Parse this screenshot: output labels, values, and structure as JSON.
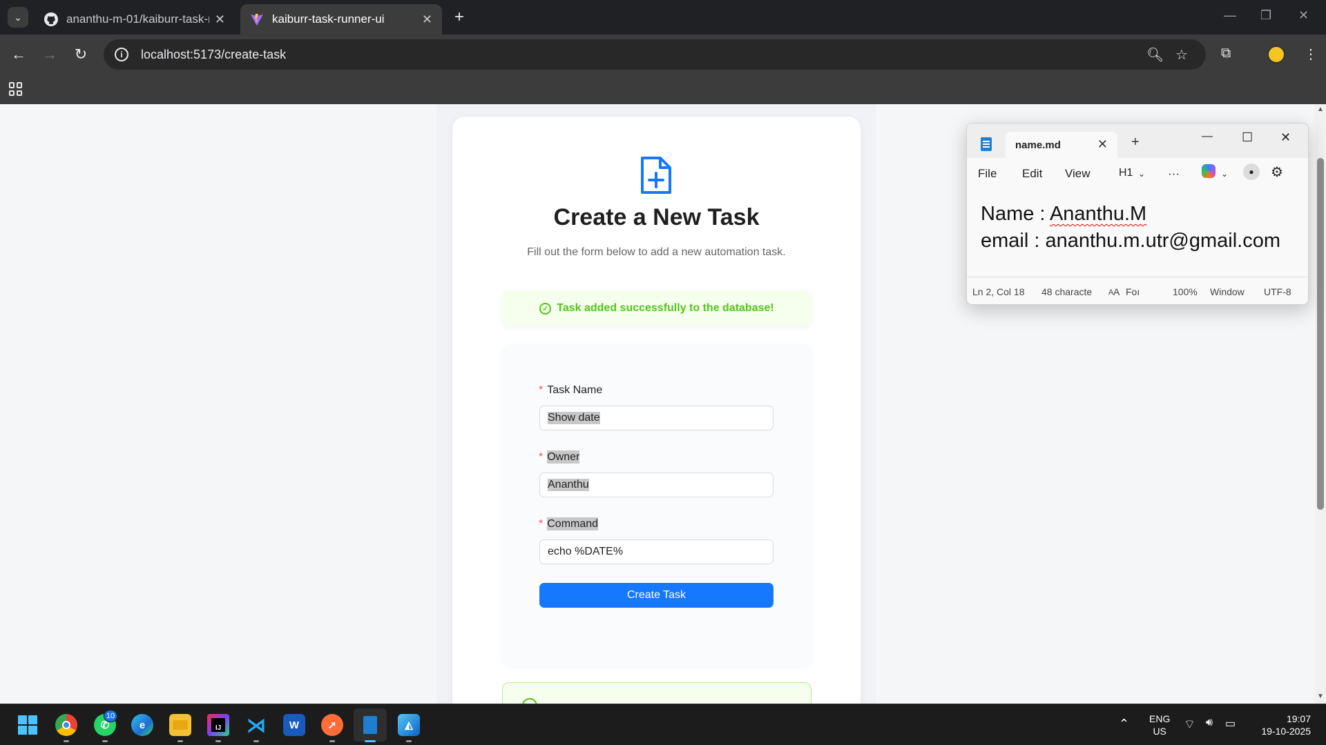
{
  "browser": {
    "tabs": [
      {
        "title": "ananthu-m-01/kaiburr-task-runn",
        "active": false
      },
      {
        "title": "kaiburr-task-runner-ui",
        "active": true
      }
    ],
    "url": "localhost:5173/create-task"
  },
  "page": {
    "title": "Create a New Task",
    "subtitle": "Fill out the form below to add a new automation task.",
    "success_message": "Task added successfully to the database!",
    "form": {
      "task_name_label": "Task Name",
      "task_name_value": "Show date",
      "owner_label": "Owner",
      "owner_value": "Ananthu",
      "command_label": "Command",
      "command_value": "echo %DATE%",
      "required_mark": "*",
      "submit_label": "Create Task"
    }
  },
  "notepad": {
    "tab_title": "name.md",
    "menu": {
      "file": "File",
      "edit": "Edit",
      "view": "View",
      "heading": "H1",
      "more": "···"
    },
    "line1_prefix": "Name : ",
    "line1_name": "Ananthu.M",
    "line2": "email : ananthu.m.utr@gmail.com",
    "status": {
      "position": "Ln 2, Col 18",
      "chars": "48 characte",
      "font_prefix": "A",
      "font": "Foı",
      "zoom": "100%",
      "line_ending": "Window",
      "encoding": "UTF-8"
    }
  },
  "taskbar": {
    "whatsapp_badge": "10",
    "language": "ENG",
    "region": "US",
    "time": "19:07",
    "date": "19-10-2025"
  },
  "colors": {
    "primary": "#1677ff",
    "success": "#52c41a",
    "required": "#ff4d4f"
  }
}
